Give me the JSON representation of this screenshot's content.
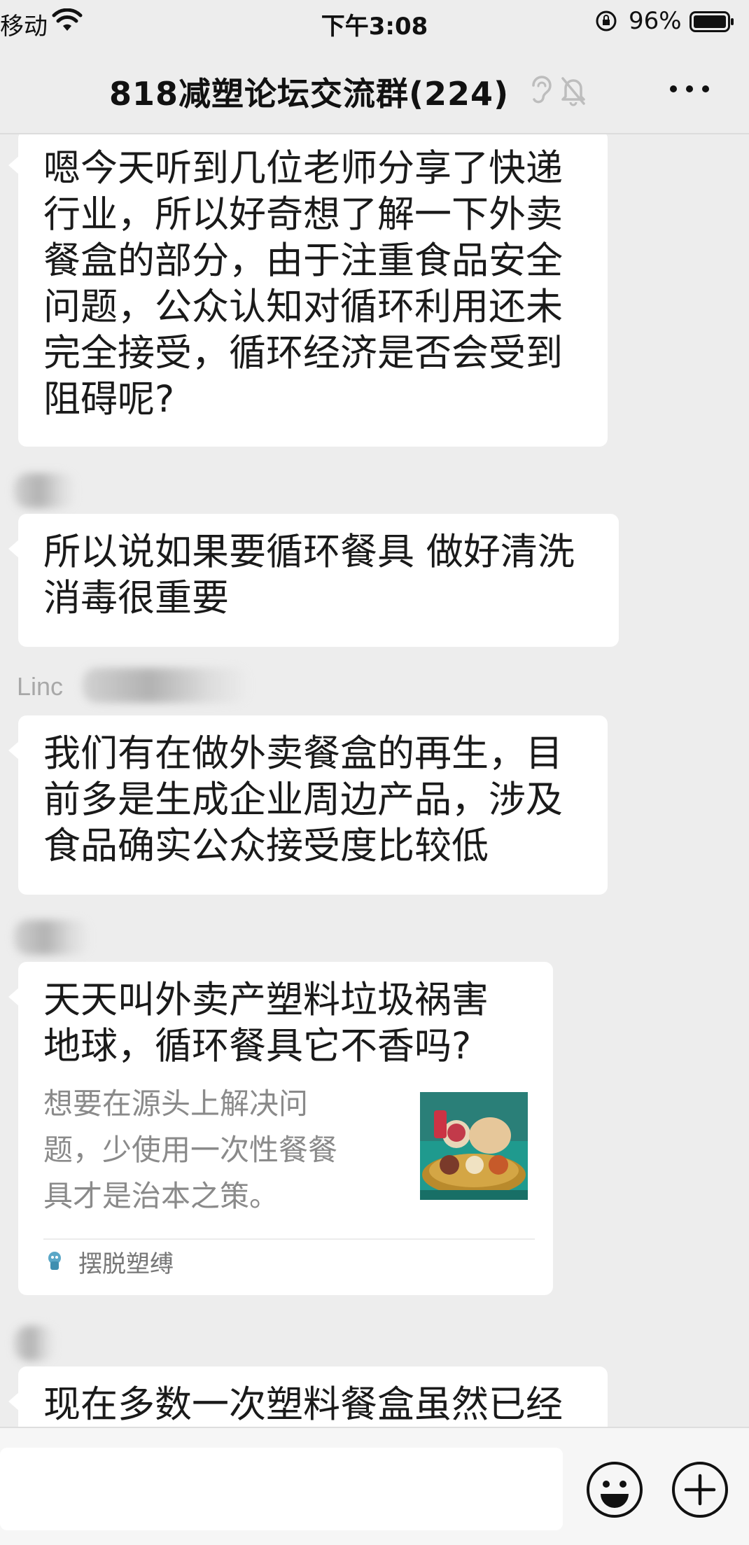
{
  "status_bar": {
    "carrier": "移动",
    "time": "下午3:08",
    "battery": "96%"
  },
  "header": {
    "title": "818减塑论坛交流群(224)"
  },
  "messages": [
    {
      "lines": [
        "嗯今天听到几位老师分享了快递",
        "行业，所以好奇想了解一下外卖",
        "餐盒的部分，由于注重食品安全",
        "问题，公众认知对循环利用还未",
        "完全接受，循环经济是否会受到",
        "阻碍呢?"
      ]
    },
    {
      "lines": [
        "所以说如果要循环餐具 做好清洗",
        "消毒很重要"
      ]
    },
    {
      "lines": [
        "我们有在做外卖餐盒的再生，目",
        "前多是生成企业周边产品，涉及",
        "食品确实公众接受度比较低"
      ]
    },
    {
      "lines": [
        "现在多数一次塑料餐盒虽然已经"
      ]
    }
  ],
  "senders": {
    "partial_name": "Linc"
  },
  "link_card": {
    "title_lines": [
      "天天叫外卖产塑料垃圾祸害",
      "地球，循环餐具它不香吗?"
    ],
    "desc_lines": [
      "想要在源头上解决问",
      "题，少使用一次性餐餐",
      "具才是治本之策。"
    ],
    "source": "摆脱塑缚",
    "thumbnail_icon": "food-plate-image"
  },
  "input": {
    "placeholder": ""
  },
  "icons": {
    "wifi": "wifi-icon",
    "lock": "rotation-lock-icon",
    "battery": "battery-icon",
    "ear": "ear-icon",
    "mute": "mute-bell-icon",
    "more": "more-icon",
    "emoji": "emoji-icon",
    "add": "plus-icon"
  }
}
